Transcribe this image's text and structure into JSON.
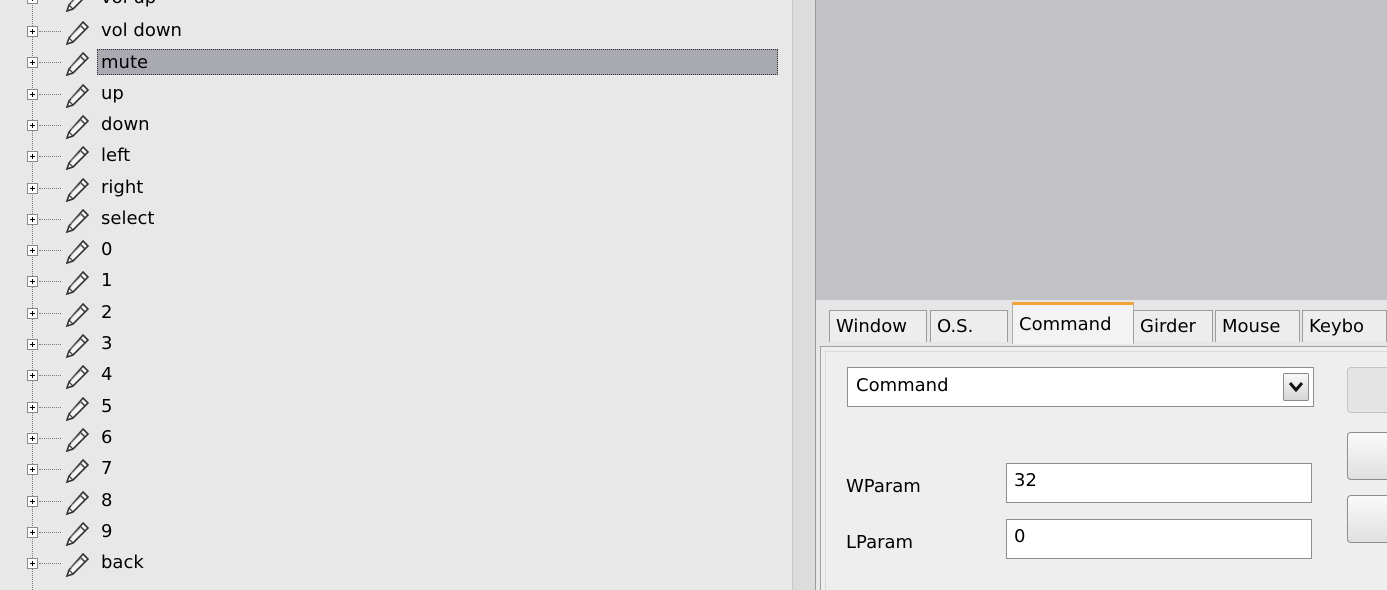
{
  "tree": {
    "partial_top_label": "vol up",
    "items": [
      {
        "label": "vol down",
        "selected": false
      },
      {
        "label": "mute",
        "selected": true
      },
      {
        "label": "up",
        "selected": false
      },
      {
        "label": "down",
        "selected": false
      },
      {
        "label": "left",
        "selected": false
      },
      {
        "label": "right",
        "selected": false
      },
      {
        "label": "select",
        "selected": false
      },
      {
        "label": "0",
        "selected": false
      },
      {
        "label": "1",
        "selected": false
      },
      {
        "label": "2",
        "selected": false
      },
      {
        "label": "3",
        "selected": false
      },
      {
        "label": "4",
        "selected": false
      },
      {
        "label": "5",
        "selected": false
      },
      {
        "label": "6",
        "selected": false
      },
      {
        "label": "7",
        "selected": false
      },
      {
        "label": "8",
        "selected": false
      },
      {
        "label": "9",
        "selected": false
      },
      {
        "label": "back",
        "selected": false
      }
    ],
    "item_icon": "pencil-icon",
    "expander_icon": "plus-box-icon"
  },
  "tabs": [
    {
      "label": "Window",
      "active": false
    },
    {
      "label": "O.S.",
      "active": false
    },
    {
      "label": "Command",
      "active": true
    },
    {
      "label": "Girder",
      "active": false
    },
    {
      "label": "Mouse",
      "active": false
    },
    {
      "label": "Keybo",
      "active": false
    }
  ],
  "command_panel": {
    "command_select_value": "Command",
    "wparam_label": "WParam",
    "wparam_value": "32",
    "lparam_label": "LParam",
    "lparam_value": "0"
  },
  "colors": {
    "selection": "#a9a9b2",
    "preview_background": "#c3c3c7",
    "active_tab_accent": "#f2a43a"
  }
}
